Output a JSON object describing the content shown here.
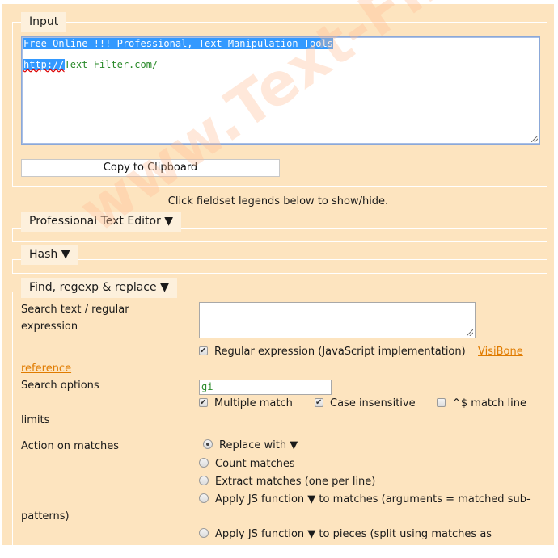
{
  "input_section": {
    "legend": "Input",
    "textarea_line1": "Free Online !!! Professional, Text Manipulation Tools ",
    "textarea_line2_selected": "http://",
    "textarea_line2_rest": "Text-Filter.com/",
    "copy_button": "Copy to Clipboard"
  },
  "hint": "Click fieldset legends below to show/hide.",
  "watermark": "www.Text-Filter.com",
  "sections": {
    "editor": {
      "legend": "Professional Text Editor ▼"
    },
    "hash": {
      "legend": "Hash ▼"
    },
    "find": {
      "legend": "Find, regexp & replace ▼",
      "search_label": "Search text / regular expression",
      "search_value": "",
      "regex_checkbox": {
        "label": "Regular expression (JavaScript implementation)",
        "checked": true
      },
      "reference_link_1": "VisiBone",
      "reference_link_2": "reference",
      "options_label": "Search options",
      "options_value": "gi",
      "multiple_match": {
        "label": "Multiple match",
        "checked": true
      },
      "case_insensitive": {
        "label": "Case insensitive",
        "checked": true
      },
      "match_line": {
        "label": "^$ match line",
        "checked": false
      },
      "match_line_cont": "limits",
      "action_label": "Action on matches",
      "actions": [
        {
          "label": "Replace with ▼",
          "selected": true
        },
        {
          "label": "Count matches",
          "selected": false
        },
        {
          "label": "Extract matches (one per line)",
          "selected": false
        },
        {
          "label": "Apply JS function ▼ to matches (arguments = matched sub-",
          "selected": false
        },
        {
          "label": "Apply JS function ▼ to pieces (split using matches as",
          "selected": false
        }
      ],
      "action_4_cont": "patterns)"
    }
  }
}
